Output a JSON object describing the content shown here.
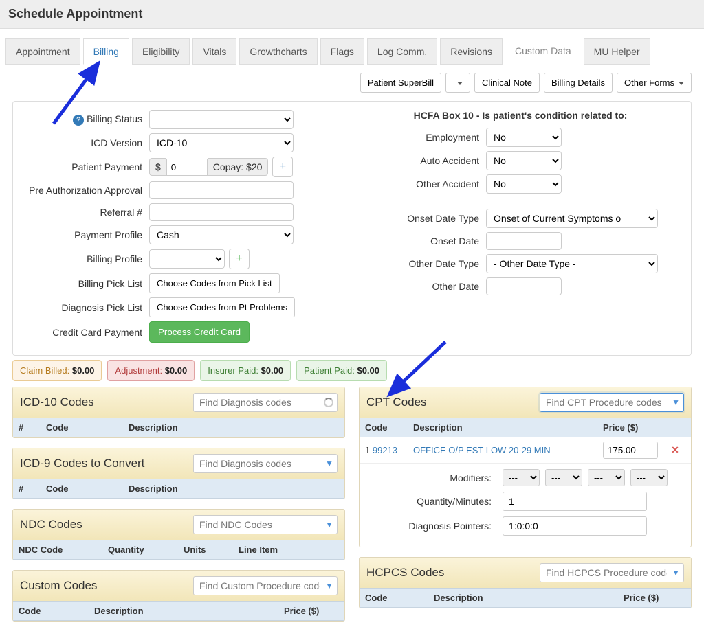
{
  "window": {
    "title": "Schedule Appointment"
  },
  "tabs": [
    "Appointment",
    "Billing",
    "Eligibility",
    "Vitals",
    "Growthcharts",
    "Flags",
    "Log Comm.",
    "Revisions",
    "Custom Data",
    "MU Helper"
  ],
  "active_tab": "Billing",
  "toolbar": {
    "patient_superbill": "Patient SuperBill",
    "clinical_note": "Clinical Note",
    "billing_details": "Billing Details",
    "other_forms": "Other Forms"
  },
  "left_form": {
    "billing_status_label": "Billing Status",
    "billing_status_value": "",
    "icd_version_label": "ICD Version",
    "icd_version_value": "ICD-10",
    "patient_payment_label": "Patient Payment",
    "patient_payment_value": "0",
    "copay_text": "Copay: $20",
    "pre_auth_label": "Pre Authorization Approval",
    "pre_auth_value": "",
    "referral_label": "Referral #",
    "referral_value": "",
    "payment_profile_label": "Payment Profile",
    "payment_profile_value": "Cash",
    "billing_profile_label": "Billing Profile",
    "billing_profile_value": "",
    "billing_picklist_label": "Billing Pick List",
    "billing_picklist_btn": "Choose Codes from Pick List",
    "diagnosis_picklist_label": "Diagnosis Pick List",
    "diagnosis_picklist_btn": "Choose Codes from Pt Problems",
    "ccpay_label": "Credit Card Payment",
    "ccpay_btn": "Process Credit Card"
  },
  "hcfa": {
    "title": "HCFA Box 10 - Is patient's condition related to:",
    "employment_label": "Employment",
    "employment_value": "No",
    "auto_label": "Auto Accident",
    "auto_value": "No",
    "other_acc_label": "Other Accident",
    "other_acc_value": "No",
    "onset_type_label": "Onset Date Type",
    "onset_type_value": "Onset of Current Symptoms o",
    "onset_date_label": "Onset Date",
    "onset_date_value": "",
    "other_date_type_label": "Other Date Type",
    "other_date_type_value": "- Other Date Type -",
    "other_date_label": "Other Date",
    "other_date_value": ""
  },
  "pills": {
    "claim_billed_label": "Claim Billed:",
    "claim_billed_value": "$0.00",
    "adjustment_label": "Adjustment:",
    "adjustment_value": "$0.00",
    "insurer_paid_label": "Insurer Paid:",
    "insurer_paid_value": "$0.00",
    "patient_paid_label": "Patient Paid:",
    "patient_paid_value": "$0.00"
  },
  "icd10": {
    "title": "ICD-10 Codes",
    "placeholder": "Find Diagnosis codes",
    "cols": {
      "n": "#",
      "code": "Code",
      "desc": "Description"
    }
  },
  "icd9": {
    "title": "ICD-9 Codes to Convert",
    "placeholder": "Find Diagnosis codes",
    "cols": {
      "n": "#",
      "code": "Code",
      "desc": "Description"
    }
  },
  "ndc": {
    "title": "NDC Codes",
    "placeholder": "Find NDC Codes",
    "cols": {
      "code": "NDC Code",
      "qty": "Quantity",
      "units": "Units",
      "line": "Line Item"
    }
  },
  "custom": {
    "title": "Custom Codes",
    "placeholder": "Find Custom Procedure codes",
    "cols": {
      "code": "Code",
      "desc": "Description",
      "price": "Price ($)"
    }
  },
  "cpt": {
    "title": "CPT Codes",
    "placeholder": "Find CPT Procedure codes",
    "cols": {
      "code": "Code",
      "desc": "Description",
      "price": "Price ($)"
    },
    "rows": [
      {
        "n": "1",
        "code": "99213",
        "desc": "OFFICE O/P EST LOW 20-29 MIN",
        "price": "175.00"
      }
    ],
    "sub": {
      "modifiers_label": "Modifiers:",
      "mod_placeholder": "---",
      "qty_label": "Quantity/Minutes:",
      "qty_value": "1",
      "dp_label": "Diagnosis Pointers:",
      "dp_value": "1:0:0:0"
    }
  },
  "hcpcs": {
    "title": "HCPCS Codes",
    "placeholder": "Find HCPCS Procedure codes",
    "cols": {
      "code": "Code",
      "desc": "Description",
      "price": "Price ($)"
    }
  }
}
